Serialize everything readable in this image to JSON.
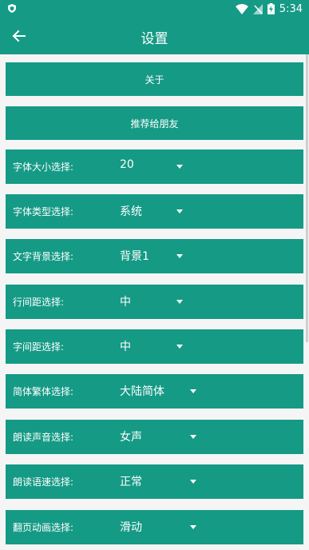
{
  "status_bar": {
    "time": "5:34"
  },
  "header": {
    "title": "设置"
  },
  "buttons": {
    "about": "关于",
    "share": "推荐给朋友"
  },
  "settings": [
    {
      "label": "字体大小选择:",
      "value": "20"
    },
    {
      "label": "字体类型选择:",
      "value": "系统"
    },
    {
      "label": "文字背景选择:",
      "value": "背景1"
    },
    {
      "label": "行间距选择:",
      "value": "中"
    },
    {
      "label": "字间距选择:",
      "value": "中"
    },
    {
      "label": "简体繁体选择:",
      "value": "大陆简体"
    },
    {
      "label": "朗读声音选择:",
      "value": "女声"
    },
    {
      "label": "朗读语速选择:",
      "value": "正常"
    },
    {
      "label": "翻页动画选择:",
      "value": "滑动"
    }
  ],
  "colors": {
    "primary": "#159a86",
    "background": "#f5f5f5"
  }
}
